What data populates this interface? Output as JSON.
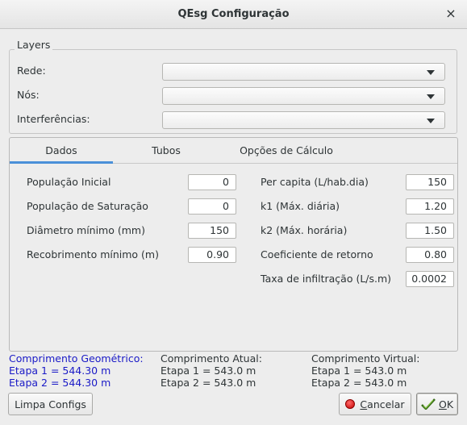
{
  "window": {
    "title": "QEsg Configuração",
    "close_glyph": "×"
  },
  "layers": {
    "group_title": "Layers",
    "fields": [
      {
        "label": "Rede:",
        "value": ""
      },
      {
        "label": "Nós:",
        "value": ""
      },
      {
        "label": "Interferências:",
        "value": ""
      }
    ]
  },
  "tabs": [
    {
      "label": "Dados",
      "active": true
    },
    {
      "label": "Tubos",
      "active": false
    },
    {
      "label": "Opções de Cálculo",
      "active": false
    }
  ],
  "dados": {
    "left": [
      {
        "label": "População Inicial",
        "value": "0"
      },
      {
        "label": "População de Saturação",
        "value": "0"
      },
      {
        "label": "Diâmetro mínimo (mm)",
        "value": "150"
      },
      {
        "label": "Recobrimento mínimo (m)",
        "value": "0.90"
      }
    ],
    "right": [
      {
        "label": "Per capita  (L/hab.dia)",
        "value": "150"
      },
      {
        "label": "k1 (Máx. diária)",
        "value": "1.20"
      },
      {
        "label": "k2 (Máx. horária)",
        "value": "1.50"
      },
      {
        "label": "Coeficiente de retorno",
        "value": "0.80"
      },
      {
        "label": "Taxa de infiltração (L/s.m)",
        "value": "0.0002"
      }
    ]
  },
  "lengths": {
    "geometric": {
      "title": "Comprimento Geométrico:",
      "etapa1": "Etapa 1 = 544.30 m",
      "etapa2": "Etapa 2 = 544.30 m"
    },
    "actual": {
      "title": "Comprimento Atual:",
      "etapa1": "Etapa 1 = 543.0 m",
      "etapa2": "Etapa 2 = 543.0 m"
    },
    "virtual": {
      "title": "Comprimento Virtual:",
      "etapa1": "Etapa 1 = 543.0 m",
      "etapa2": "Etapa 2 = 543.0 m"
    }
  },
  "buttons": {
    "clear": "Limpa Configs",
    "cancel_mnemonic": "C",
    "cancel_rest": "ancelar",
    "ok_mnemonic": "O",
    "ok_rest": "K"
  },
  "colors": {
    "accent": "#4a90d9",
    "info_blue": "#1a1ac7"
  }
}
